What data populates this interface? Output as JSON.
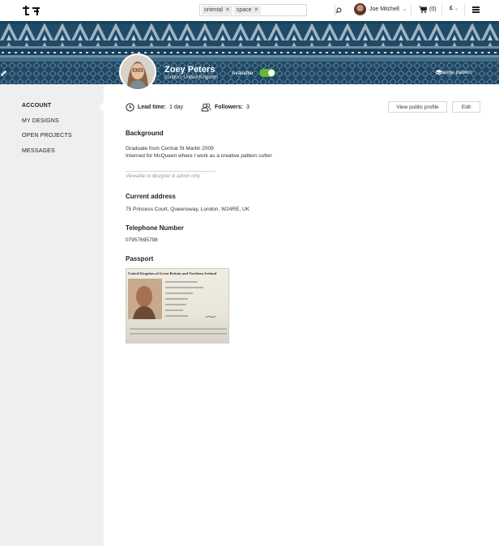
{
  "header": {
    "search": {
      "tags": [
        "oriental",
        "space"
      ],
      "placeholder": ""
    },
    "user_name": "Joe Mitchell",
    "cart": "(0)",
    "currency": "£"
  },
  "banner": {
    "name": "Zoey Peters",
    "location": "London, United Kingdom",
    "availability_label": "Available",
    "available": true,
    "change_pattern": "Change pattern"
  },
  "sidebar": {
    "items": [
      {
        "label": "ACCOUNT",
        "active": true
      },
      {
        "label": "MY DESIGNS"
      },
      {
        "label": "OPEN PROJECTS"
      },
      {
        "label": "MESSAGES"
      }
    ]
  },
  "profile": {
    "lead_time_label": "Lead time:",
    "lead_time_value": "1 day",
    "followers_label": "Followers:",
    "followers_value": "3",
    "view_public_button": "View public profile",
    "edit_button": "Edit",
    "background_title": "Background",
    "background_lines": [
      "Graduate from Central St Martin 2009",
      "Interned for McQueen where I work as a creative pattern cutter"
    ],
    "visibility_note": "Viewable to designer & admin only",
    "address_title": "Current address",
    "address": "75 Princess Court, Queensway, London, W24RE, UK",
    "phone_title": "Telephone Number",
    "phone": "07957695798",
    "passport_title": "Passport",
    "passport_header": "United Kingdom of Great Britain and Northern Ireland"
  },
  "colors": {
    "banner": "#1f4a68",
    "toggle_on": "#67b637",
    "sidebar_bg": "#efefef"
  }
}
